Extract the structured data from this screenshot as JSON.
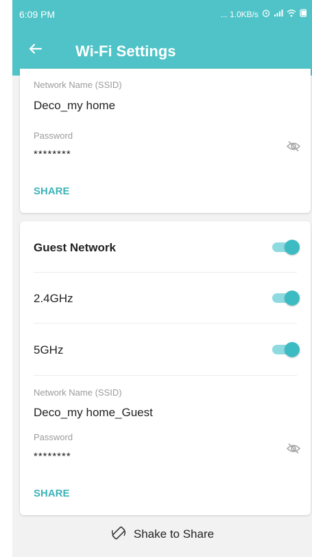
{
  "status_bar": {
    "time": "6:09 PM",
    "net_speed": "... 1.0KB/s"
  },
  "header": {
    "title": "Wi-Fi Settings",
    "bg_color": "#4fc3c7"
  },
  "main_network": {
    "ssid_label": "Network Name (SSID)",
    "ssid_value": "Deco_my home",
    "password_label": "Password",
    "password_value": "********",
    "share_label": "SHARE"
  },
  "guest_network": {
    "title": "Guest Network",
    "enabled": true,
    "bands": [
      {
        "label": "2.4GHz",
        "enabled": true
      },
      {
        "label": "5GHz",
        "enabled": true
      }
    ],
    "ssid_label": "Network Name (SSID)",
    "ssid_value": "Deco_my home_Guest",
    "password_label": "Password",
    "password_value": "********",
    "share_label": "SHARE"
  },
  "footer": {
    "shake_label": "Shake to Share"
  },
  "colors": {
    "accent": "#3cb3b8",
    "toggle_on": "#3cbcc2"
  }
}
